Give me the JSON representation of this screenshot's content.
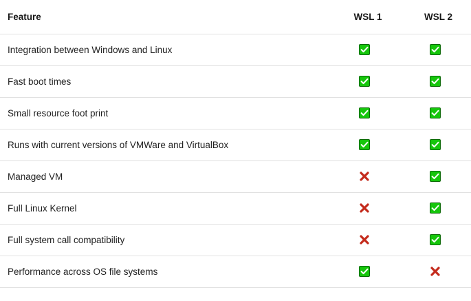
{
  "header": {
    "feature": "Feature",
    "wsl1": "WSL 1",
    "wsl2": "WSL 2"
  },
  "rows": [
    {
      "feature": "Integration between Windows and Linux",
      "wsl1": "check",
      "wsl2": "check"
    },
    {
      "feature": "Fast boot times",
      "wsl1": "check",
      "wsl2": "check"
    },
    {
      "feature": "Small resource foot print",
      "wsl1": "check",
      "wsl2": "check"
    },
    {
      "feature": "Runs with current versions of VMWare and VirtualBox",
      "wsl1": "check",
      "wsl2": "check"
    },
    {
      "feature": "Managed VM",
      "wsl1": "cross",
      "wsl2": "check"
    },
    {
      "feature": "Full Linux Kernel",
      "wsl1": "cross",
      "wsl2": "check"
    },
    {
      "feature": "Full system call compatibility",
      "wsl1": "cross",
      "wsl2": "check"
    },
    {
      "feature": "Performance across OS file systems",
      "wsl1": "check",
      "wsl2": "cross"
    }
  ],
  "colors": {
    "check_fill": "#16c60c",
    "check_border": "#0b6a06",
    "cross": "#c42b1c"
  },
  "icons": {
    "check": "check-icon",
    "cross": "cross-icon"
  }
}
